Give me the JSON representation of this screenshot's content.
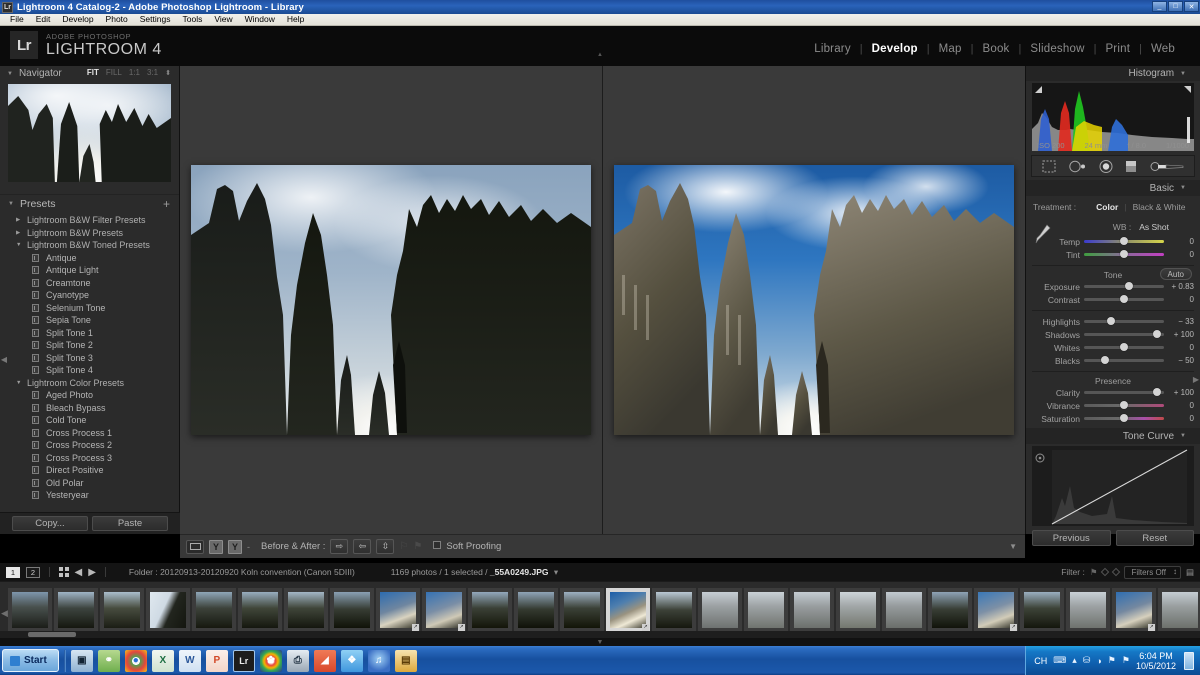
{
  "window": {
    "title": "Lightroom 4 Catalog-2 - Adobe Photoshop Lightroom - Library",
    "app_icon": "Lr",
    "controls": {
      "minimize": "_",
      "maximize": "□",
      "close": "✕"
    }
  },
  "menubar": [
    "File",
    "Edit",
    "Develop",
    "Photo",
    "Settings",
    "Tools",
    "View",
    "Window",
    "Help"
  ],
  "branding": {
    "badge": "Lr",
    "superline": "ADOBE PHOTOSHOP",
    "product": "LIGHTROOM 4"
  },
  "modules": [
    {
      "label": "Library",
      "active": false
    },
    {
      "label": "Develop",
      "active": true
    },
    {
      "label": "Map",
      "active": false
    },
    {
      "label": "Book",
      "active": false
    },
    {
      "label": "Slideshow",
      "active": false
    },
    {
      "label": "Print",
      "active": false
    },
    {
      "label": "Web",
      "active": false
    }
  ],
  "navigator": {
    "title": "Navigator",
    "zoom_modes": [
      {
        "label": "FIT",
        "active": true
      },
      {
        "label": "FILL",
        "active": false
      },
      {
        "label": "1:1",
        "active": false
      },
      {
        "label": "3:1",
        "active": false
      }
    ]
  },
  "presets": {
    "title": "Presets",
    "add_label": "+",
    "groups": [
      {
        "name": "Lightroom B&W Filter Presets",
        "expanded": false,
        "items": []
      },
      {
        "name": "Lightroom B&W Presets",
        "expanded": false,
        "items": []
      },
      {
        "name": "Lightroom B&W Toned Presets",
        "expanded": true,
        "items": [
          "Antique",
          "Antique Light",
          "Creamtone",
          "Cyanotype",
          "Selenium Tone",
          "Sepia Tone",
          "Split Tone 1",
          "Split Tone 2",
          "Split Tone 3",
          "Split Tone 4"
        ]
      },
      {
        "name": "Lightroom Color Presets",
        "expanded": true,
        "items": [
          "Aged Photo",
          "Bleach Bypass",
          "Cold Tone",
          "Cross Process 1",
          "Cross Process 2",
          "Cross Process 3",
          "Direct Positive",
          "Old Polar",
          "Yesteryear"
        ]
      }
    ]
  },
  "left_buttons": {
    "copy": "Copy...",
    "paste": "Paste"
  },
  "toolbar": {
    "before_after_label": "Before & After :",
    "soft_proofing_label": "Soft Proofing",
    "yy_left": "Y",
    "yy_right": "Y",
    "dash": "-"
  },
  "histogram": {
    "title": "Histogram",
    "iso": "ISO 200",
    "focal": "24 mm",
    "aperture": "f / 8.0",
    "shutter": "1/1000"
  },
  "basic": {
    "title": "Basic",
    "treatment_label": "Treatment :",
    "treatment_color": "Color",
    "treatment_bw": "Black & White",
    "wb_label": "WB :",
    "wb_value": "As Shot",
    "white_balance": [
      {
        "name": "Temp",
        "value": "0",
        "pos": 50,
        "type": "temp"
      },
      {
        "name": "Tint",
        "value": "0",
        "pos": 50,
        "type": "tint"
      }
    ],
    "tone_title": "Tone",
    "auto_label": "Auto",
    "tone": [
      {
        "name": "Exposure",
        "value": "+ 0.83",
        "pos": 56
      },
      {
        "name": "Contrast",
        "value": "0",
        "pos": 50
      }
    ],
    "tone2": [
      {
        "name": "Highlights",
        "value": "− 33",
        "pos": 34
      },
      {
        "name": "Shadows",
        "value": "+ 100",
        "pos": 91
      },
      {
        "name": "Whites",
        "value": "0",
        "pos": 50
      },
      {
        "name": "Blacks",
        "value": "− 50",
        "pos": 26
      }
    ],
    "presence_title": "Presence",
    "presence": [
      {
        "name": "Clarity",
        "value": "+ 100",
        "pos": 91,
        "type": "plain"
      },
      {
        "name": "Vibrance",
        "value": "0",
        "pos": 50,
        "type": "vibrance"
      },
      {
        "name": "Saturation",
        "value": "0",
        "pos": 50,
        "type": "saturation"
      }
    ]
  },
  "tone_curve": {
    "title": "Tone Curve"
  },
  "right_buttons": {
    "previous": "Previous",
    "reset": "Reset"
  },
  "filmstrip_bar": {
    "page_1": "1",
    "page_2": "2",
    "folder_text": "Folder : 20120913-20120920 Koln convention (Canon 5DIII)",
    "count_prefix": "1169 photos / 1 selected / ",
    "filename": "_55A0249.JPG",
    "filter_label": "Filter :",
    "filter_value": "Filters Off"
  },
  "filmstrip": {
    "selected_index": 13,
    "thumbnails": [
      {
        "kind": "dark",
        "badge": ""
      },
      {
        "kind": "dark",
        "badge": ""
      },
      {
        "kind": "dark",
        "badge": ""
      },
      {
        "kind": "sky",
        "badge": ""
      },
      {
        "kind": "dark",
        "badge": ""
      },
      {
        "kind": "dark",
        "badge": ""
      },
      {
        "kind": "dark",
        "badge": ""
      },
      {
        "kind": "dark",
        "badge": ""
      },
      {
        "kind": "edit",
        "badge": "↗"
      },
      {
        "kind": "edit",
        "badge": "↗"
      },
      {
        "kind": "dark",
        "badge": ""
      },
      {
        "kind": "dark",
        "badge": ""
      },
      {
        "kind": "dark",
        "badge": ""
      },
      {
        "kind": "edit",
        "badge": "↗"
      },
      {
        "kind": "dark",
        "badge": ""
      },
      {
        "kind": "grey",
        "badge": ""
      },
      {
        "kind": "grey",
        "badge": ""
      },
      {
        "kind": "grey",
        "badge": ""
      },
      {
        "kind": "grey",
        "badge": ""
      },
      {
        "kind": "grey",
        "badge": ""
      },
      {
        "kind": "dark",
        "badge": ""
      },
      {
        "kind": "edit",
        "badge": "↗"
      },
      {
        "kind": "dark",
        "badge": ""
      },
      {
        "kind": "grey",
        "badge": ""
      },
      {
        "kind": "edit",
        "badge": "↗"
      },
      {
        "kind": "grey",
        "badge": ""
      },
      {
        "kind": "dark",
        "badge": ""
      }
    ]
  },
  "taskbar": {
    "start_label": "Start",
    "quick_icons": [
      {
        "name": "show-desktop-icon",
        "glyph": "▣",
        "color": "#7aa3cc"
      },
      {
        "name": "network-icon",
        "glyph": "⚭",
        "color": "#6fae4d"
      },
      {
        "name": "chrome-icon",
        "glyph": "●",
        "color": "#e6453c"
      },
      {
        "name": "excel-icon",
        "glyph": "X",
        "color": "#1d6f42"
      },
      {
        "name": "word-icon",
        "glyph": "W",
        "color": "#2b579a"
      },
      {
        "name": "powerpoint-icon",
        "glyph": "P",
        "color": "#d24726"
      },
      {
        "name": "lightroom-icon",
        "glyph": "Lr",
        "color": "#2a2a2a",
        "active": true
      },
      {
        "name": "picasa-icon",
        "glyph": "✿",
        "color": "#2b3a8f"
      },
      {
        "name": "scanner-icon",
        "glyph": "⎙",
        "color": "#9aa7b4"
      },
      {
        "name": "reader-icon",
        "glyph": "◢",
        "color": "#d8482c"
      },
      {
        "name": "dropbox-icon",
        "glyph": "❖",
        "color": "#4ba3e3"
      },
      {
        "name": "itunes-icon",
        "glyph": "♫",
        "color": "#3b6fc4"
      },
      {
        "name": "explorer-icon",
        "glyph": "▤",
        "color": "#e0b44a"
      }
    ],
    "tray": {
      "lang": "CH",
      "icons": [
        "⌨",
        "▴",
        "⛁",
        "◑",
        "⚑",
        "⚑"
      ],
      "time": "6:04 PM",
      "date": "10/5/2012"
    }
  }
}
